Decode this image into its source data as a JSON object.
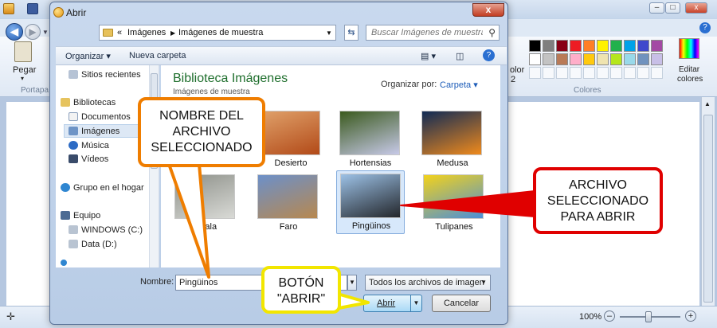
{
  "paint": {
    "colors_group_label": "Colores",
    "edit_colors_label_line1": "Editar",
    "edit_colors_label_line2": "colores",
    "paste_label": "Pegar",
    "clipboard_group_label": "Portapa",
    "color2_label_line1": "olor",
    "color2_label_line2": "2",
    "zoom_level": "100%",
    "palette_row1": [
      "#000000",
      "#7f7f7f",
      "#880015",
      "#ed1c24",
      "#ff7f27",
      "#fff200",
      "#22b14c",
      "#00a2e8",
      "#3f48cc",
      "#a349a4"
    ],
    "palette_row2": [
      "#ffffff",
      "#c3c3c3",
      "#b97a57",
      "#ffaec9",
      "#ffc90e",
      "#efe4b0",
      "#b5e61d",
      "#99d9ea",
      "#7092be",
      "#c8bfe7"
    ]
  },
  "dialog": {
    "title": "Abrir",
    "close_label": "x",
    "address": {
      "root_sep": "«",
      "crumbs": [
        "Imágenes",
        "Imágenes de muestra"
      ]
    },
    "search": {
      "placeholder": "Buscar Imágenes de muestra"
    },
    "toolbar": {
      "organize_label": "Organizar",
      "new_folder_label": "Nueva carpeta"
    },
    "nav": {
      "recent": "Sitios recientes",
      "libraries": "Bibliotecas",
      "documents": "Documentos",
      "images": "Imágenes",
      "music": "Música",
      "videos": "Vídeos",
      "homegroup": "Grupo en el hogar",
      "computer": "Equipo",
      "drive_c": "WINDOWS (C:)",
      "drive_d": "Data (D:)"
    },
    "library": {
      "title": "Biblioteca Imágenes",
      "subtitle": "Imágenes de muestra",
      "arrange_label": "Organizar por:",
      "arrange_value": "Carpeta"
    },
    "files": [
      {
        "name": "Desierto",
        "thumb_colors": [
          "#e0a16a",
          "#b24a18"
        ]
      },
      {
        "name": "Hortensias",
        "thumb_colors": [
          "#3b5a1e",
          "#c7c9e8"
        ]
      },
      {
        "name": "Medusa",
        "thumb_colors": [
          "#102a55",
          "#f08a1c"
        ]
      },
      {
        "name": "Koala",
        "thumb_colors": [
          "#8c8f88",
          "#d9dad6"
        ]
      },
      {
        "name": "Faro",
        "thumb_colors": [
          "#6c90c9",
          "#b7884f"
        ]
      },
      {
        "name": "Pingüinos",
        "thumb_colors": [
          "#9cc1e6",
          "#23262b"
        ]
      },
      {
        "name": "Tulipanes",
        "thumb_colors": [
          "#f3d21b",
          "#4b8fd8"
        ]
      }
    ],
    "filename_label": "Nombre:",
    "filename_value": "Pingüinos",
    "filter_value": "Todos los archivos de imagen",
    "open_label": "Abrir",
    "cancel_label": "Cancelar"
  },
  "callouts": {
    "name": [
      "NOMBRE DEL",
      "ARCHIVO",
      "SELECCIONADO"
    ],
    "selected": [
      "ARCHIVO",
      "SELECCIONADO",
      "PARA ABRIR"
    ],
    "open": [
      "BOTÓN",
      "\"ABRIR\""
    ]
  }
}
